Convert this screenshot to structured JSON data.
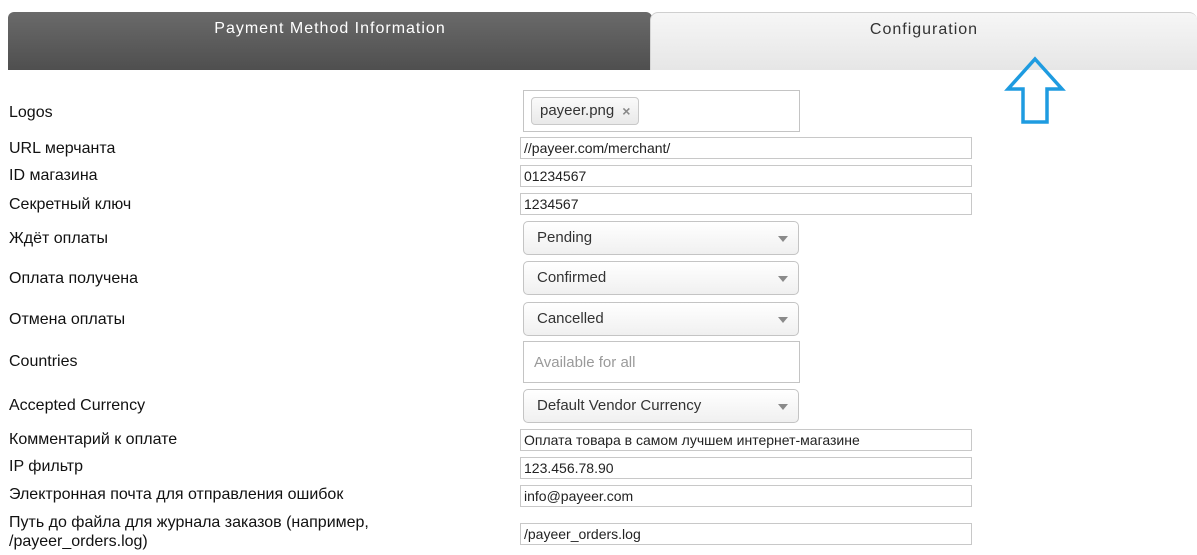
{
  "tabs": {
    "left_label": "Payment Method Information",
    "right_label": "Configuration"
  },
  "annotation": {
    "arrow_color": "#1e9be0",
    "icon": "up-arrow-icon"
  },
  "form": {
    "logos": {
      "label": "Logos",
      "chip": "payeer.png",
      "remove_glyph": "×"
    },
    "merchant_url": {
      "label": "URL мерчанта",
      "value": "//payeer.com/merchant/"
    },
    "shop_id": {
      "label": "ID магазина",
      "value": "01234567"
    },
    "secret_key": {
      "label": "Секретный ключ",
      "value": "1234567"
    },
    "pending_status": {
      "label": "Ждёт оплаты",
      "selected": "Pending"
    },
    "confirmed_status": {
      "label": "Оплата получена",
      "selected": "Confirmed"
    },
    "cancelled_status": {
      "label": "Отмена оплаты",
      "selected": "Cancelled"
    },
    "countries": {
      "label": "Countries",
      "placeholder": "Available for all"
    },
    "currency": {
      "label": "Accepted Currency",
      "selected": "Default Vendor Currency"
    },
    "payment_comment": {
      "label": "Комментарий к оплате",
      "value": "Оплата товара в самом лучшем интернет-магазине"
    },
    "ip_filter": {
      "label": "IP фильтр",
      "value": "123.456.78.90"
    },
    "error_email": {
      "label": "Электронная почта для отправления ошибок",
      "value": "info@payeer.com"
    },
    "orders_log": {
      "label_line1": "Путь до файла для журнала заказов (например,",
      "label_line2": "/payeer_orders.log)",
      "value": "/payeer_orders.log"
    }
  }
}
